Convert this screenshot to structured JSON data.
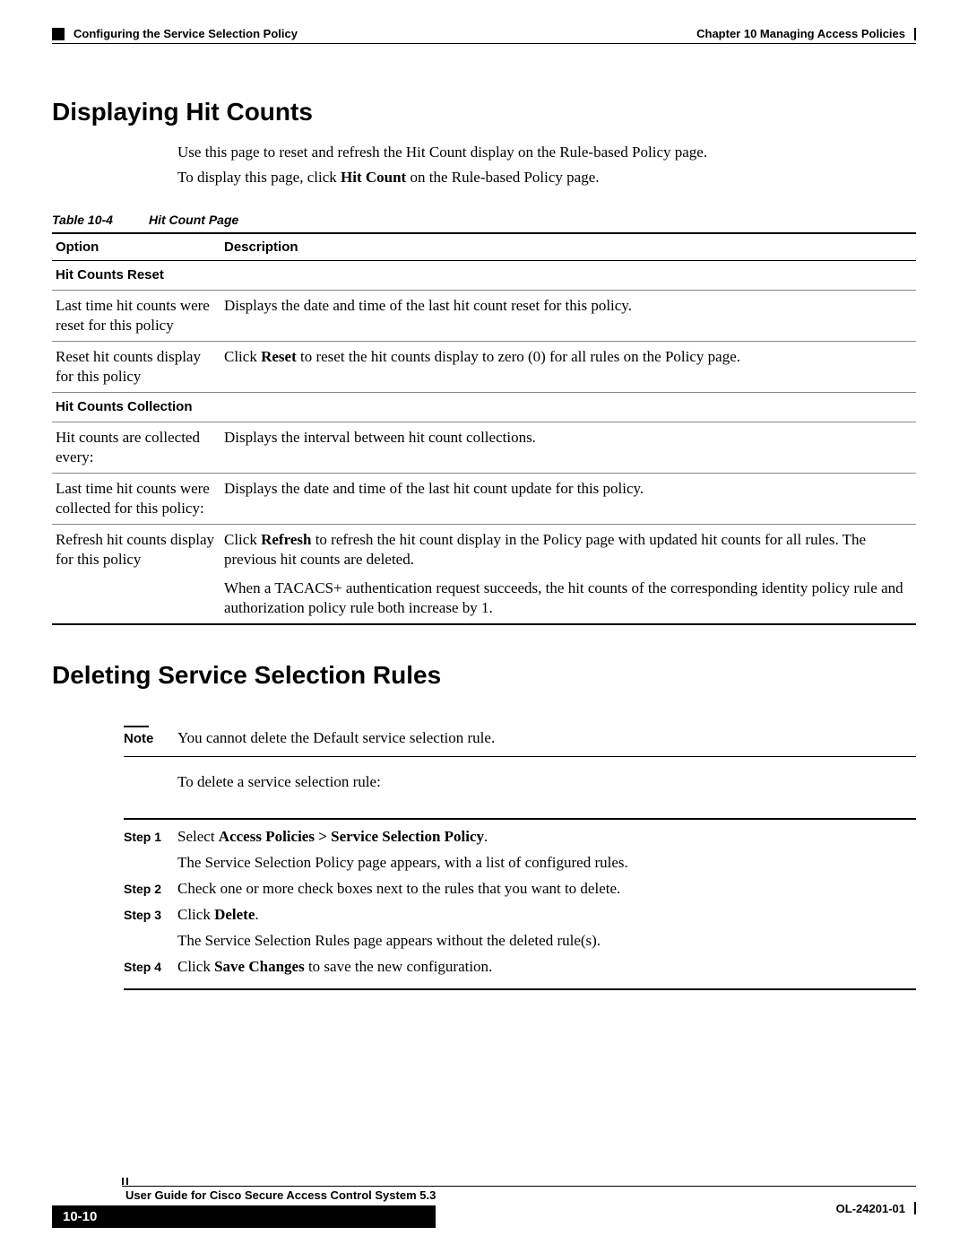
{
  "header": {
    "chapter": "Chapter 10    Managing Access Policies",
    "section": "Configuring the Service Selection Policy"
  },
  "h1": "Displaying Hit Counts",
  "intro1": "Use this page to reset and refresh the Hit Count display on the Rule-based Policy page.",
  "intro2_a": "To display this page, click ",
  "intro2_b": "Hit Count",
  "intro2_c": " on the Rule-based Policy page.",
  "tableCaptionNum": "Table 10-4",
  "tableCaptionTitle": "Hit Count Page",
  "th_option": "Option",
  "th_desc": "Description",
  "sub1": "Hit Counts Reset",
  "r1_opt": "Last time hit counts were reset for this policy",
  "r1_desc": "Displays the date and time of the last hit count reset for this policy.",
  "r2_opt": "Reset hit counts display for this policy",
  "r2_desc_a": "Click ",
  "r2_desc_b": "Reset",
  "r2_desc_c": " to reset the hit counts display to zero (0) for all rules on the Policy page.",
  "sub2": "Hit Counts Collection",
  "r3_opt": "Hit counts are collected every:",
  "r3_desc": "Displays the interval between hit count collections.",
  "r4_opt": "Last time hit counts were collected for this policy:",
  "r4_desc": "Displays the date and time of the last hit count update for this policy.",
  "r5_opt": "Refresh hit counts display for this policy",
  "r5_desc1_a": "Click ",
  "r5_desc1_b": "Refresh",
  "r5_desc1_c": " to refresh the hit count display in the Policy page with updated hit counts for all rules. The previous hit counts are deleted.",
  "r5_desc2": "When a TACACS+ authentication request succeeds, the hit counts of the corresponding identity policy rule and authorization policy rule both increase by 1.",
  "h2": "Deleting Service Selection Rules",
  "noteLabel": "Note",
  "noteText": "You cannot delete the Default service selection rule.",
  "noteAfter": "To delete a service selection rule:",
  "step1Label": "Step 1",
  "step1_a": "Select ",
  "step1_b": "Access Policies > Service Selection Policy",
  "step1_c": ".",
  "step1_after": "The Service Selection Policy page appears, with a list of configured rules.",
  "step2Label": "Step 2",
  "step2": "Check one or more check boxes next to the rules that you want to delete.",
  "step3Label": "Step 3",
  "step3_a": "Click ",
  "step3_b": "Delete",
  "step3_c": ".",
  "step3_after": "The Service Selection Rules page appears without the deleted rule(s).",
  "step4Label": "Step 4",
  "step4_a": "Click ",
  "step4_b": "Save Changes",
  "step4_c": " to save the new configuration.",
  "footerTitle": "User Guide for Cisco Secure Access Control System 5.3",
  "pageNum": "10-10",
  "docId": "OL-24201-01"
}
